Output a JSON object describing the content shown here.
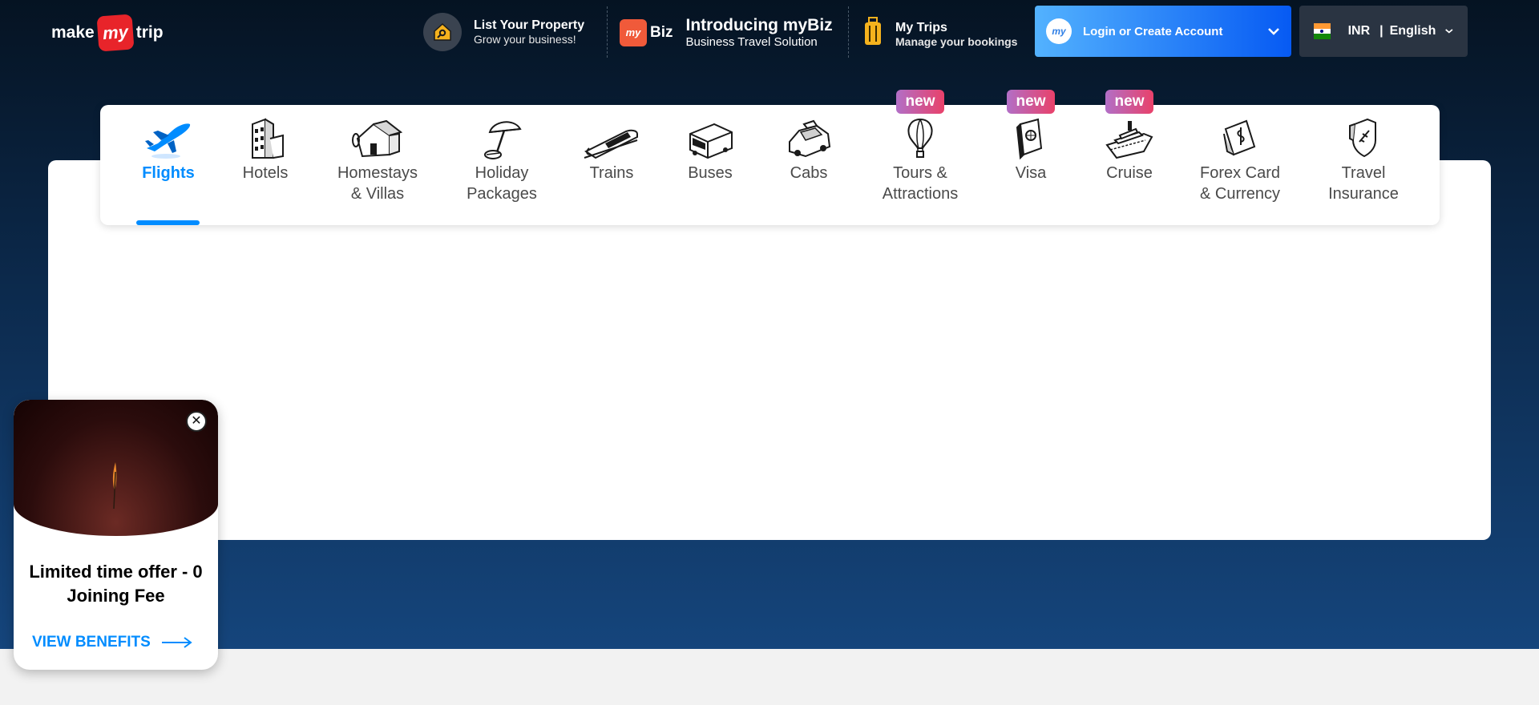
{
  "header": {
    "logo": {
      "pre": "make",
      "mid": "my",
      "post": "trip"
    },
    "list_property": {
      "title": "List Your Property",
      "subtitle": "Grow your business!"
    },
    "mybiz": {
      "badge_my": "my",
      "badge_biz": "Biz",
      "title": "Introducing myBiz",
      "subtitle": "Business Travel Solution"
    },
    "my_trips": {
      "title": "My Trips",
      "subtitle": "Manage your bookings"
    },
    "login": {
      "avatar_text": "my",
      "label": "Login or Create Account"
    },
    "locale": {
      "currency": "INR",
      "separator": "|",
      "language": "English"
    }
  },
  "nav": {
    "items": [
      {
        "label": "Flights",
        "icon": "plane-icon",
        "active": true
      },
      {
        "label": "Hotels",
        "icon": "hotel-icon"
      },
      {
        "label": "Homestays\n& Villas",
        "icon": "house-icon"
      },
      {
        "label": "Holiday\nPackages",
        "icon": "beach-umbrella-icon"
      },
      {
        "label": "Trains",
        "icon": "train-icon"
      },
      {
        "label": "Buses",
        "icon": "bus-icon"
      },
      {
        "label": "Cabs",
        "icon": "cab-icon"
      },
      {
        "label": "Tours &\nAttractions",
        "icon": "hot-air-balloon-icon",
        "badge": "new"
      },
      {
        "label": "Visa",
        "icon": "passport-icon",
        "badge": "new"
      },
      {
        "label": "Cruise",
        "icon": "cruise-ship-icon",
        "badge": "new"
      },
      {
        "label": "Forex Card\n& Currency",
        "icon": "forex-card-icon"
      },
      {
        "label": "Travel\nInsurance",
        "icon": "insurance-shield-icon"
      }
    ]
  },
  "popup": {
    "title": "Limited time offer - 0 Joining Fee",
    "cta": "VIEW BENEFITS",
    "close": "✕"
  },
  "colors": {
    "accent": "#008cff",
    "login_gradient_start": "#53b2fe",
    "login_gradient_end": "#065af3",
    "badge_gradient_start": "#b26fc7",
    "badge_gradient_end": "#e9416a",
    "brand_red": "#e8242a"
  }
}
